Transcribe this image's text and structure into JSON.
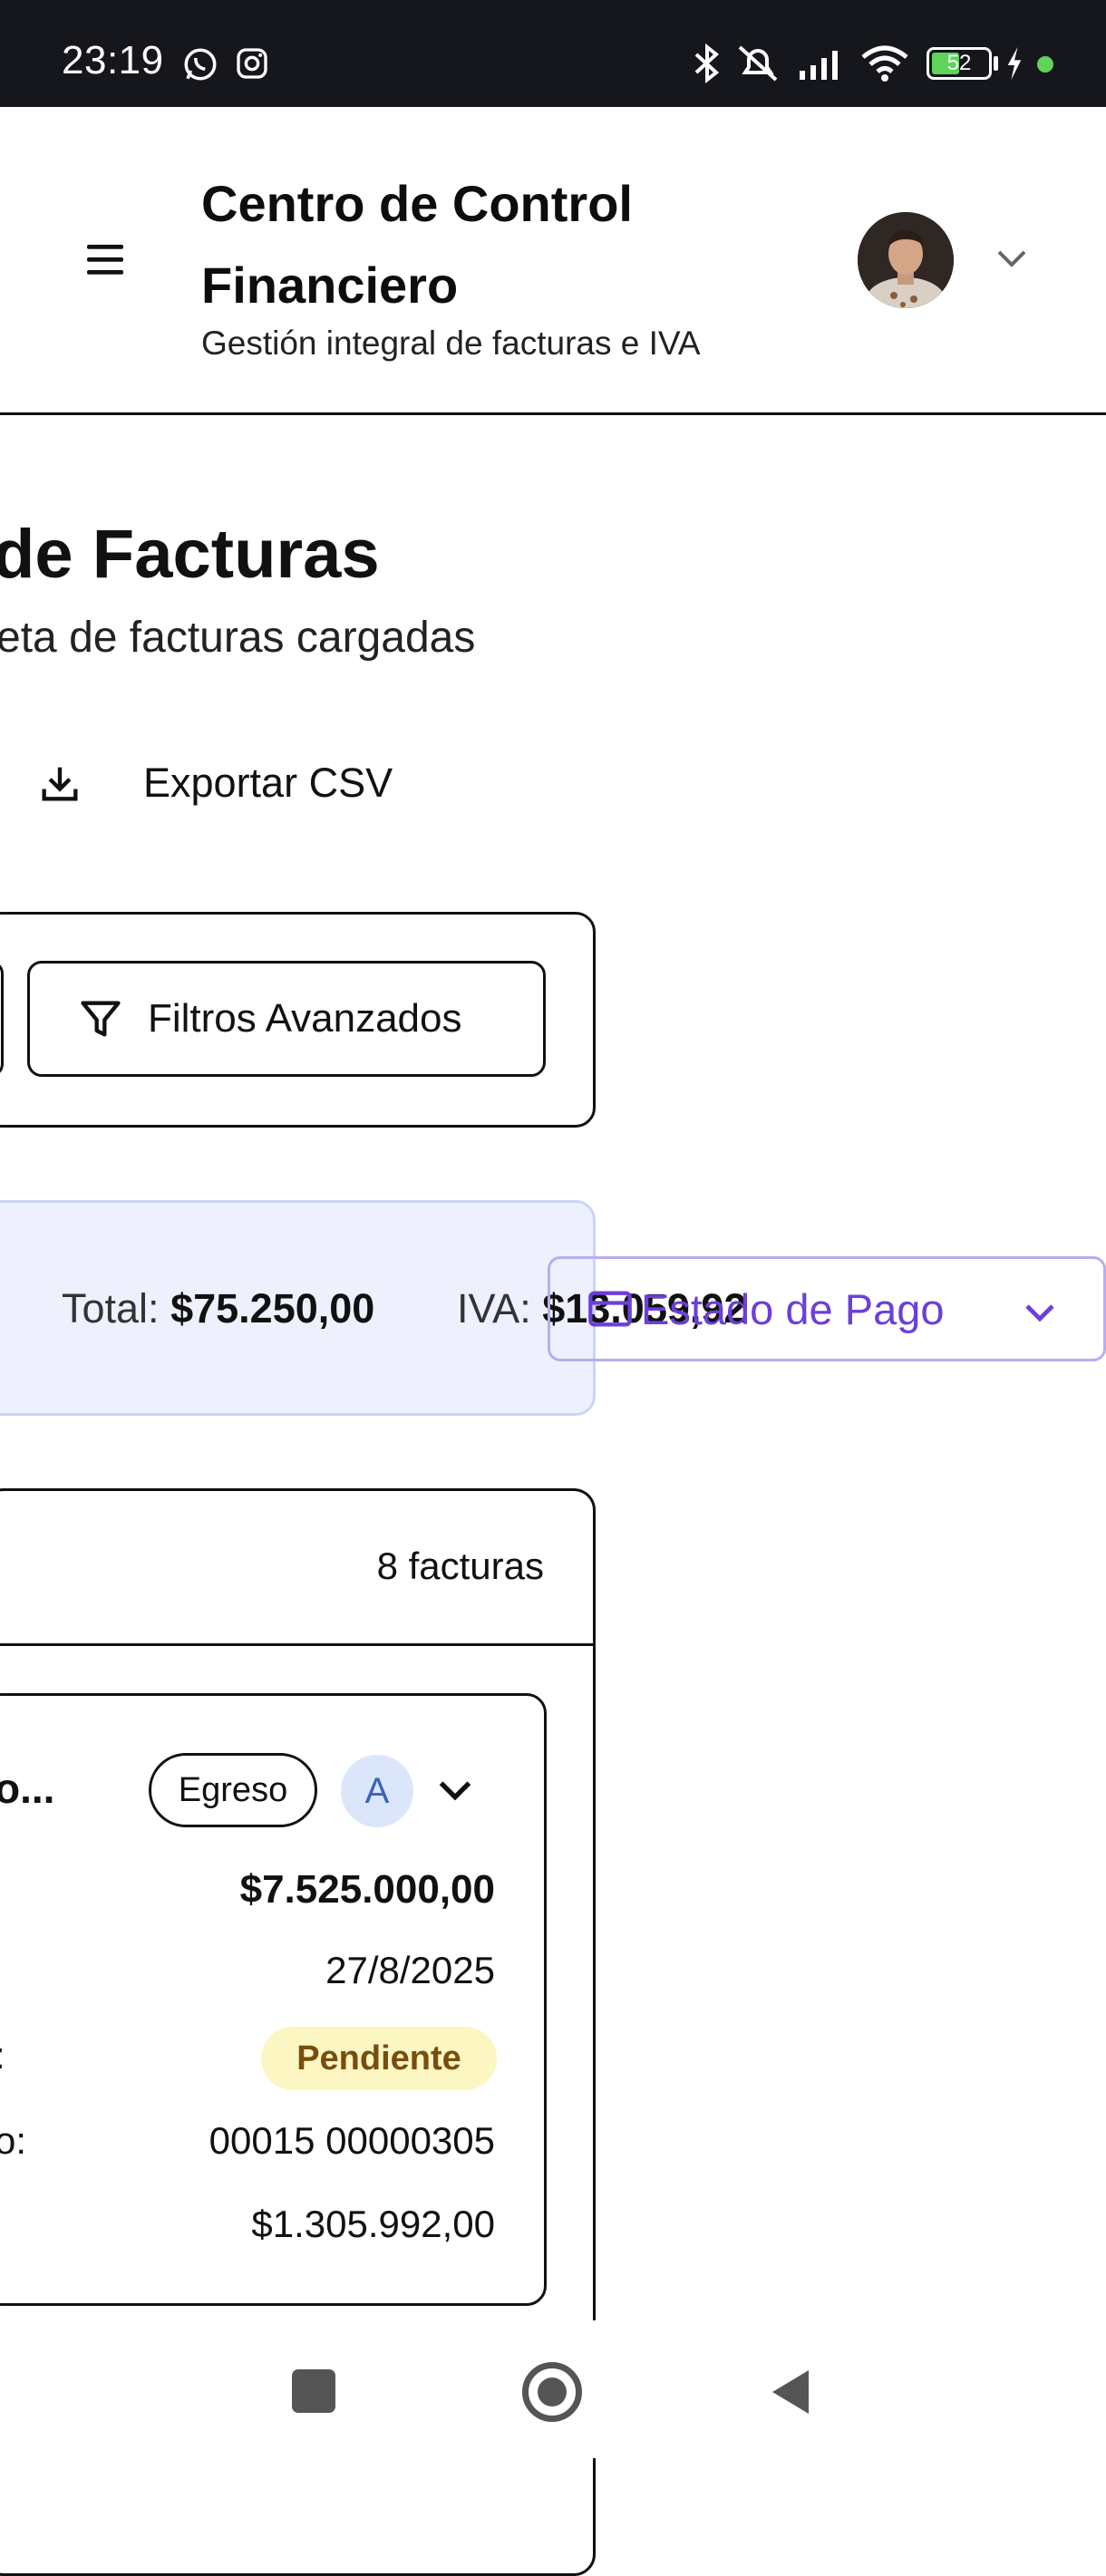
{
  "status_bar": {
    "time": "23:19",
    "battery": "52",
    "icons": [
      "whatsapp-icon",
      "instagram-icon",
      "bluetooth-icon",
      "mute-icon",
      "signal-icon",
      "wifi-icon",
      "battery-icon",
      "charging-icon"
    ]
  },
  "header": {
    "title": "Centro de Control Financiero",
    "subtitle": "Gestión integral de facturas e IVA"
  },
  "page": {
    "title": "de Facturas",
    "subtitle": "eta de facturas cargadas",
    "export_label": "Exportar CSV",
    "filters_label": "Filtros Avanzados"
  },
  "summary": {
    "total_label": "Total:",
    "total_value": "$75.250,00",
    "iva_label": "IVA:",
    "iva_value": "$13.059,92",
    "estado_label": "Estado de Pago"
  },
  "list": {
    "count": "8 facturas",
    "invoice": {
      "name": "o...",
      "type": "Egreso",
      "letter": "A",
      "amount": "$7.525.000,00",
      "date": "27/8/2025",
      "status_label_frag": ":",
      "status": "Pendiente",
      "number_label_frag": "o:",
      "number": "00015 00000305",
      "iva": "$1.305.992,00"
    }
  },
  "colors": {
    "accent": "#6d3fd9",
    "summary_bg": "#eef1fd",
    "pending_bg": "#fcf6c3",
    "pending_text": "#7a4d0c",
    "badge_bg": "#dbe6fb"
  }
}
